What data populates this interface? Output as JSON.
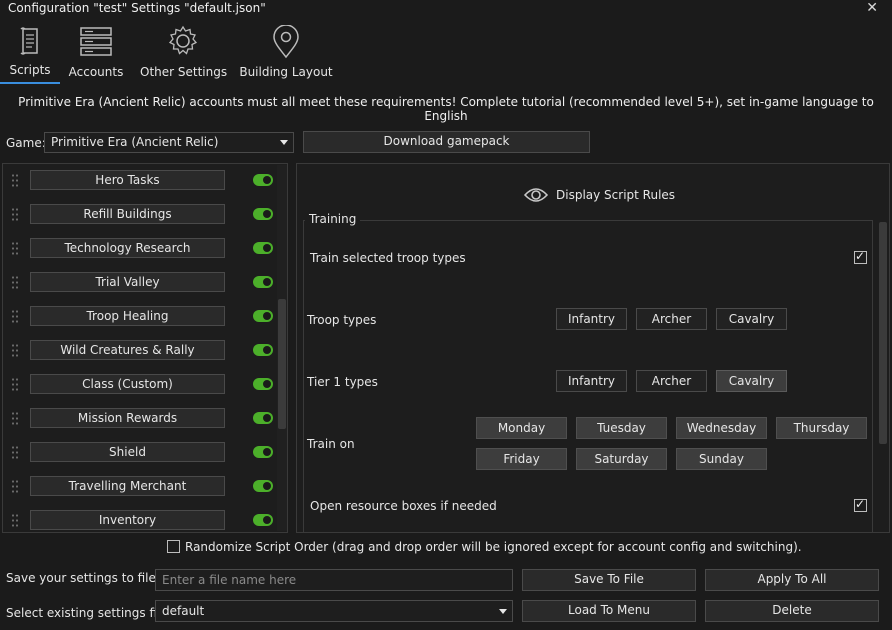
{
  "window": {
    "title": "Configuration \"test\" Settings \"default.json\"",
    "close_glyph": "✕"
  },
  "tabs": [
    {
      "label": "Scripts",
      "icon": "scroll-icon",
      "active": true
    },
    {
      "label": "Accounts",
      "icon": "server-list-icon"
    },
    {
      "label": "Other Settings",
      "icon": "gear-icon"
    },
    {
      "label": "Building Layout",
      "icon": "map-pin-icon"
    }
  ],
  "notice": "Primitive Era (Ancient Relic) accounts must all meet these requirements! Complete tutorial (recommended level 5+), set in-game language to English",
  "game": {
    "label": "Game:",
    "selected": "Primitive Era (Ancient Relic)",
    "download_label": "Download gamepack"
  },
  "scripts": [
    {
      "label": "Hero Tasks",
      "enabled": true
    },
    {
      "label": "Refill Buildings",
      "enabled": true
    },
    {
      "label": "Technology Research",
      "enabled": true
    },
    {
      "label": "Trial Valley",
      "enabled": true
    },
    {
      "label": "Troop Healing",
      "enabled": true
    },
    {
      "label": "Wild Creatures & Rally",
      "enabled": true
    },
    {
      "label": "Class (Custom)",
      "enabled": true
    },
    {
      "label": "Mission Rewards",
      "enabled": true
    },
    {
      "label": "Shield",
      "enabled": true
    },
    {
      "label": "Travelling Merchant",
      "enabled": true
    },
    {
      "label": "Inventory",
      "enabled": true
    }
  ],
  "settings": {
    "rules_label": "Display Script Rules",
    "group_title": "Training",
    "train_selected_label": "Train selected troop types",
    "train_selected_checked": true,
    "troop_types_label": "Troop types",
    "troop_types": [
      {
        "label": "Infantry",
        "selected": false
      },
      {
        "label": "Archer",
        "selected": false
      },
      {
        "label": "Cavalry",
        "selected": false
      }
    ],
    "tier1_label": "Tier 1 types",
    "tier1_types": [
      {
        "label": "Infantry",
        "selected": false
      },
      {
        "label": "Archer",
        "selected": false
      },
      {
        "label": "Cavalry",
        "selected": true
      }
    ],
    "train_on_label": "Train on",
    "days": [
      "Monday",
      "Tuesday",
      "Wednesday",
      "Thursday",
      "Friday",
      "Saturday",
      "Sunday"
    ],
    "open_boxes_label": "Open resource boxes if needed",
    "open_boxes_checked": true
  },
  "randomize": {
    "label": "Randomize Script Order (drag and drop order will be ignored except for account config and switching).",
    "checked": false
  },
  "save": {
    "label": "Save your settings to file",
    "placeholder": "Enter a file name here",
    "save_button": "Save To File",
    "apply_button": "Apply To All"
  },
  "load": {
    "label": "Select existing settings file",
    "selected": "default",
    "load_button": "Load To Menu",
    "delete_button": "Delete"
  },
  "colors": {
    "accent": "#3a8ede",
    "toggle_on": "#4caf2a",
    "background": "#1b1b1b"
  }
}
